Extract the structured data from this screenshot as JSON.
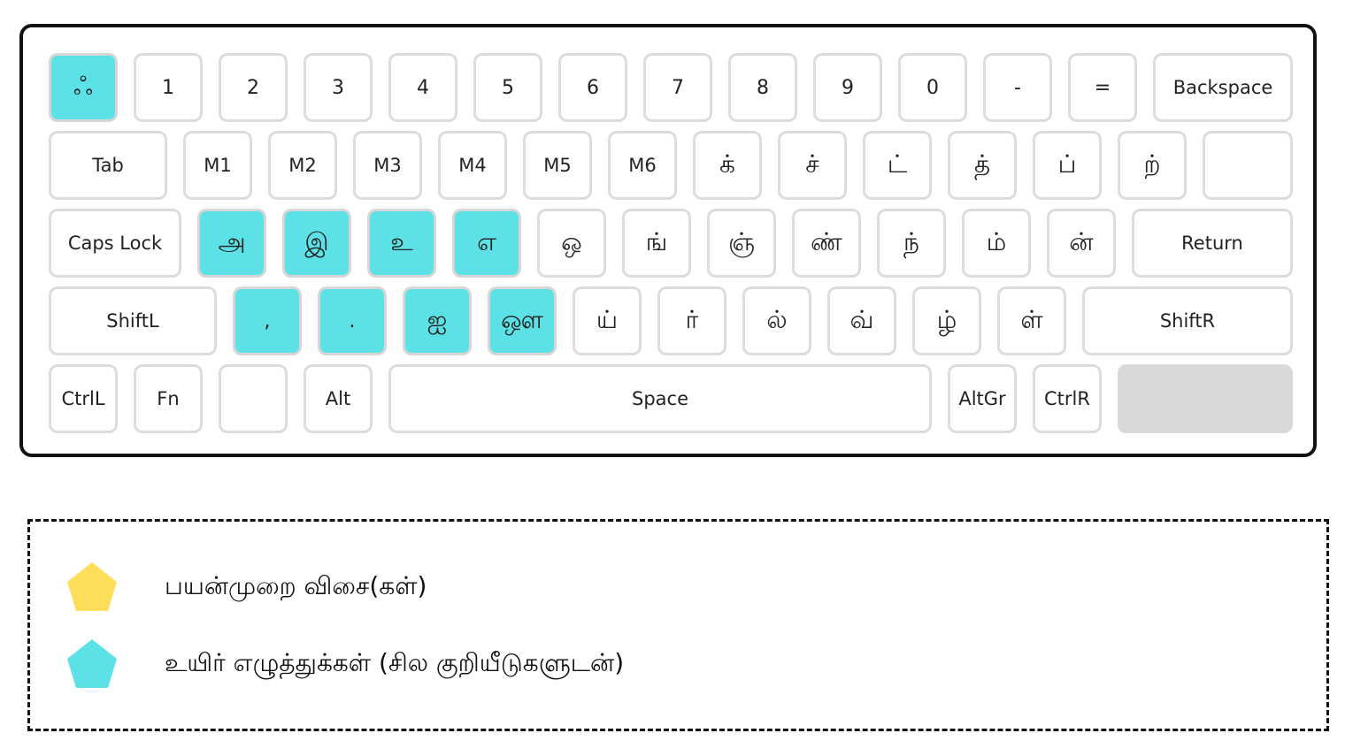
{
  "colors": {
    "vowel_highlight": "#5ce1e6",
    "usage_key": "#ffde59",
    "key_border": "#dcdcdc",
    "keyboard_border": "#111111"
  },
  "keyboard": {
    "row1": [
      "ஃ",
      "1",
      "2",
      "3",
      "4",
      "5",
      "6",
      "7",
      "8",
      "9",
      "0",
      "-",
      "=",
      "Backspace"
    ],
    "row2": [
      "Tab",
      "M1",
      "M2",
      "M3",
      "M4",
      "M5",
      "M6",
      "க்",
      "ச்",
      "ட்",
      "த்",
      "ப்",
      "ற்",
      ""
    ],
    "row3": [
      "Caps Lock",
      "அ",
      "இ",
      "உ",
      "எ",
      "ஒ",
      "ங்",
      "ஞ்",
      "ண்",
      "ந்",
      "ம்",
      "ன்",
      "Return"
    ],
    "row4": [
      "ShiftL",
      ",",
      ".",
      "ஐ",
      "ஔ",
      "ய்",
      "ர்",
      "ல்",
      "வ்",
      "ழ்",
      "ள்",
      "ShiftR"
    ],
    "row5": [
      "CtrlL",
      "Fn",
      "",
      "Alt",
      "Space",
      "AltGr",
      "CtrlR",
      ""
    ]
  },
  "legend": {
    "items": [
      {
        "label": "பயன்முறை விசை(கள்)",
        "icon": "pentagon-icon",
        "color": "#ffde59"
      },
      {
        "label": "உயிர் எழுத்துக்கள் (சில குறியீடுகளுடன்)",
        "icon": "pentagon-icon",
        "color": "#5ce1e6"
      }
    ]
  }
}
